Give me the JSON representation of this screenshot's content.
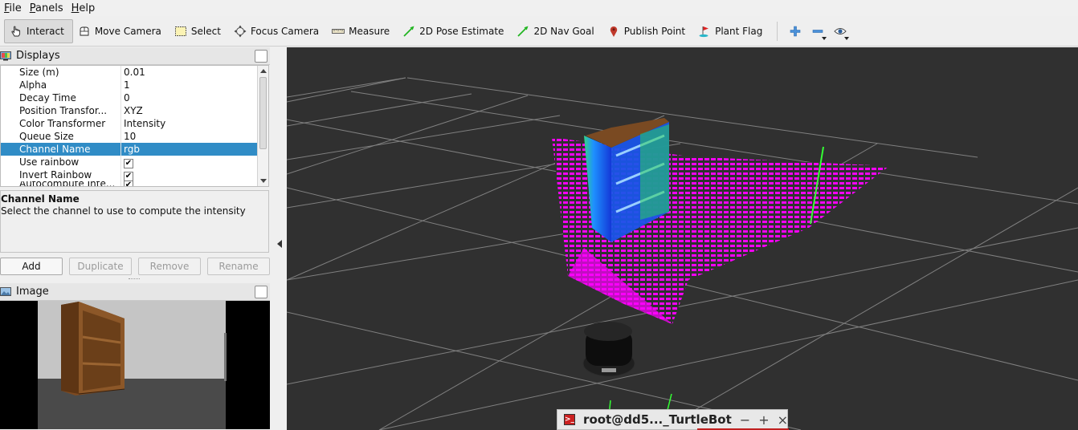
{
  "menubar": {
    "items": [
      {
        "label": "File",
        "u": "F",
        "rest": "ile"
      },
      {
        "label": "Panels",
        "u": "P",
        "rest": "anels"
      },
      {
        "label": "Help",
        "u": "H",
        "rest": "elp"
      }
    ]
  },
  "toolbar": {
    "interact": "Interact",
    "move_camera": "Move Camera",
    "select": "Select",
    "focus_camera": "Focus Camera",
    "measure": "Measure",
    "pose_estimate": "2D Pose Estimate",
    "nav_goal": "2D Nav Goal",
    "publish_point": "Publish Point",
    "plant_flag": "Plant Flag",
    "active_tool": "Interact"
  },
  "displays": {
    "title": "Displays",
    "rows": [
      {
        "key": "Size (m)",
        "value": "0.01"
      },
      {
        "key": "Alpha",
        "value": "1"
      },
      {
        "key": "Decay Time",
        "value": "0"
      },
      {
        "key": "Position Transfor...",
        "value": "XYZ"
      },
      {
        "key": "Color Transformer",
        "value": "Intensity"
      },
      {
        "key": "Queue Size",
        "value": "10"
      },
      {
        "key": "Channel Name",
        "value": "rgb"
      },
      {
        "key": "Use rainbow",
        "value": ""
      },
      {
        "key": "Invert Rainbow",
        "value": ""
      },
      {
        "key": "Autocompute Inte...",
        "value": ""
      }
    ],
    "checked": {
      "use_rainbow": true,
      "invert_rainbow": true,
      "autocompute": true
    },
    "selected_row": "Channel Name"
  },
  "description": {
    "title": "Channel Name",
    "text": "Select the channel to use to compute the intensity"
  },
  "buttons": {
    "add": "Add",
    "duplicate": "Duplicate",
    "remove": "Remove",
    "rename": "Rename"
  },
  "image_panel": {
    "title": "Image"
  },
  "taskbar": {
    "window_title": "root@dd5..._TurtleBot",
    "minimize": "−",
    "maximize": "+",
    "close": "×"
  },
  "colors": {
    "selection": "#308cc6",
    "view_background": "#303030",
    "laser_scan": "#ff00ff",
    "grid": "#a0a0a0"
  }
}
